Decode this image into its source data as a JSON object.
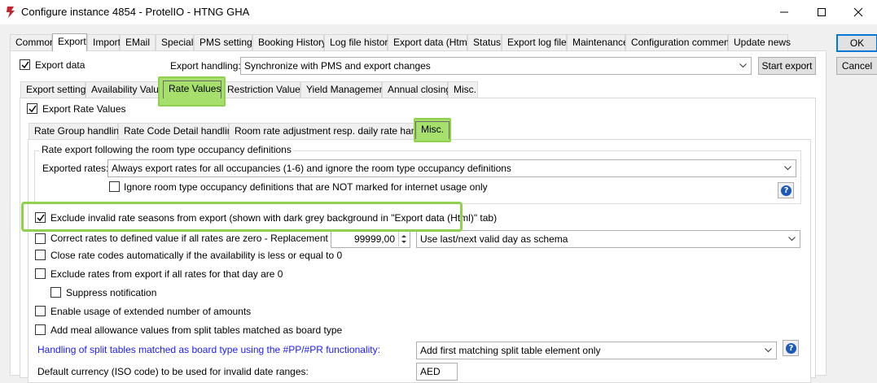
{
  "window": {
    "title": "Configure instance 4854 - ProtelIO - HTNG GHA",
    "icon": "protelio-logo-icon",
    "controls": [
      "minimize-icon",
      "maximize-icon",
      "close-icon"
    ]
  },
  "top_tabs": [
    "Common",
    "Export",
    "Import",
    "EMail",
    "Special",
    "PMS settings",
    "Booking History",
    "Log file history",
    "Export data (Html)",
    "Status",
    "Export log files",
    "Maintenance",
    "Configuration comments",
    "Update news"
  ],
  "top_tabs_selected": "Export",
  "dialog_buttons": {
    "ok": "OK",
    "cancel": "Cancel"
  },
  "export": {
    "export_data_label": "Export data",
    "export_data_checked": true,
    "handling_label": "Export handling:",
    "handling_value": "Synchronize with PMS and export changes",
    "start_export": "Start export"
  },
  "sub_tabs": [
    "Export settings",
    "Availability Values",
    "Rate Values",
    "Restriction Values",
    "Yield Management",
    "Annual closing",
    "Misc."
  ],
  "sub_tabs_selected": "Rate Values",
  "rate_values": {
    "export_rate_values_label": "Export Rate Values",
    "export_rate_values_checked": true,
    "inner_tabs": [
      "Rate Group handling",
      "Rate Code Detail handling",
      "Room rate adjustment resp. daily rate handling",
      "Misc."
    ],
    "inner_tabs_selected": "Misc."
  },
  "misc": {
    "group_title": "Rate export following the room type occupancy definitions",
    "exported_rates_label": "Exported rates:",
    "exported_rates_value": "Always export rates for all occupancies (1-6) and ignore the room type occupancy definitions",
    "ignore_label": "Ignore room type occupancy definitions that are NOT marked for internet usage only",
    "ignore_checked": false,
    "exclude_label": "Exclude invalid rate seasons from export (shown with dark grey background in \"Export data (Html)\" tab)",
    "exclude_checked": true,
    "correct_label": "Correct rates to defined value if all rates are zero - Replacement value:",
    "correct_checked": false,
    "replacement_value": "99999,00",
    "schema_value": "Use last/next valid day as schema",
    "close_codes_label": "Close rate codes automatically if the availability is less or equal to 0",
    "close_codes_checked": false,
    "exclude_zero_label": "Exclude rates from export if all rates for that day are 0",
    "exclude_zero_checked": false,
    "suppress_label": "Suppress notification",
    "suppress_checked": false,
    "extended_label": "Enable usage of extended number of amounts",
    "extended_checked": false,
    "meal_label": "Add meal allowance values from split tables matched as board type",
    "meal_checked": false,
    "split_label": "Handling of split tables matched as board type using the #PP/#PR functionality:",
    "split_value": "Add first matching split table element only",
    "currency_label": "Default currency (ISO code) to be used for invalid date ranges:",
    "currency_value": "AED",
    "help_glyph": "?"
  },
  "colors": {
    "highlight": "#8fd14f",
    "link": "#1a1aff",
    "accent": "#0078d7",
    "help_icon": "#1b58b8",
    "app_icon": "#c0262d"
  }
}
